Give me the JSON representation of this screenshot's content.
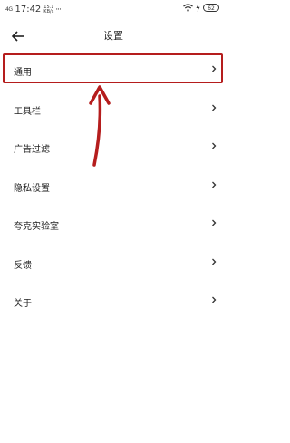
{
  "status_bar": {
    "signal": "4G",
    "time": "17:42",
    "network_speed": "15.1 KB/s",
    "more": "···",
    "battery": "62"
  },
  "header": {
    "back_icon": "arrow-left-icon",
    "title": "设置"
  },
  "menu": {
    "items": [
      {
        "label": "通用"
      },
      {
        "label": "工具栏"
      },
      {
        "label": "广告过滤"
      },
      {
        "label": "隐私设置"
      },
      {
        "label": "夸克实验室"
      },
      {
        "label": "反馈"
      },
      {
        "label": "关于"
      }
    ]
  },
  "annotation": {
    "color": "#b51d1d"
  }
}
